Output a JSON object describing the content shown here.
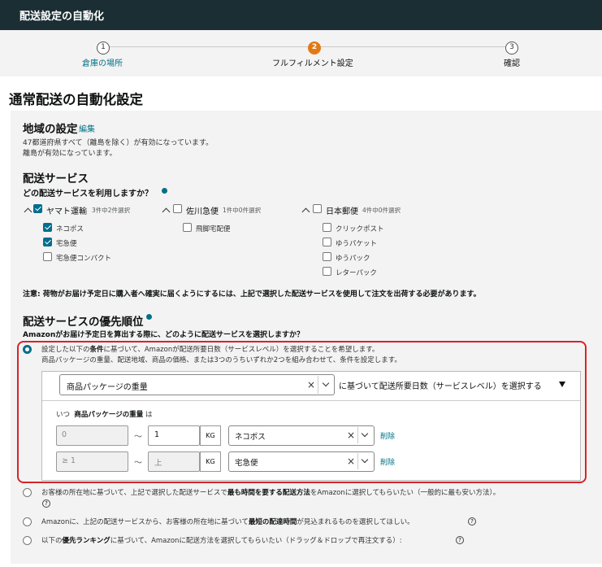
{
  "header": {
    "title": "配送設定の自動化"
  },
  "steps": [
    {
      "num": "1",
      "label": "倉庫の場所",
      "state": "done"
    },
    {
      "num": "2",
      "label": "フルフィルメント設定",
      "state": "active"
    },
    {
      "num": "3",
      "label": "確認",
      "state": "pending"
    }
  ],
  "page_title": "通常配送の自動化設定",
  "region": {
    "title": "地域の設定",
    "edit": "編集",
    "line1": "47都道府県すべて（離島を除く）が有効になっています。",
    "line2": "離島が有効になっています。"
  },
  "services": {
    "title": "配送サービス",
    "question": "どの配送サービスを利用しますか？",
    "carriers": [
      {
        "name": "ヤマト運輸",
        "count": "3件中2件選択",
        "checked": true,
        "items": [
          {
            "label": "ネコポス",
            "checked": true
          },
          {
            "label": "宅急便",
            "checked": true
          },
          {
            "label": "宅急便コンパクト",
            "checked": false
          }
        ]
      },
      {
        "name": "佐川急便",
        "count": "1件中0件選択",
        "checked": false,
        "items": [
          {
            "label": "飛脚宅配便",
            "checked": false
          }
        ]
      },
      {
        "name": "日本郵便",
        "count": "4件中0件選択",
        "checked": false,
        "items": [
          {
            "label": "クリックポスト",
            "checked": false
          },
          {
            "label": "ゆうパケット",
            "checked": false
          },
          {
            "label": "ゆうパック",
            "checked": false
          },
          {
            "label": "レターパック",
            "checked": false
          }
        ]
      }
    ],
    "note": "注意: 荷物がお届け予定日に購入者へ確実に届くようにするには、上記で選択した配送サービスを使用して注文を出荷する必要があります。"
  },
  "priority": {
    "title": "配送サービスの優先順位",
    "question": "Amazonがお届け予定日を算出する際に、どのように配送サービスを選択しますか？",
    "opt1": {
      "a": "設定した以下の",
      "b": "条件",
      "c": "に基づいて、Amazonが配送所要日数（サービスレベル）を選択することを希望します。",
      "sub": "商品パッケージの重量、配送地域、商品の価格、または3つのうちいずれか2つを組み合わせて、条件を設定します。"
    },
    "condition": {
      "select": "商品パッケージの重量",
      "suffix": "に基づいて配送所要日数（サービスレベル）を選択する",
      "when_a": "いつ",
      "when_b": "商品パッケージの重量",
      "when_c": "は",
      "rows": [
        {
          "from": "0",
          "from_ph": "",
          "to": "1",
          "to_ph": "",
          "unit": "KG",
          "service": "ネコポス",
          "delete": "削除"
        },
        {
          "from": "",
          "from_ph": "≥ 1",
          "to": "",
          "to_ph": "上",
          "unit": "KG",
          "service": "宅急便",
          "delete": "削除"
        }
      ],
      "tilde": "～"
    },
    "opt2": {
      "a": "お客様の所在地に基づいて、上記で選択した配送サービスで",
      "b": "最も時間を要する配送方法",
      "c": "をAmazonに選択してもらいたい（一般的に最も安い方法）。"
    },
    "opt3": {
      "a": "Amazonに、上記の配送サービスから、お客様の所在地に基づいて",
      "b": "最短の配達時間",
      "c": "が見込まれるものを選択してほしい。"
    },
    "opt4": {
      "a": "以下の",
      "b": "優先ランキング",
      "c": "に基づいて、Amazonに配送方法を選択してもらいたい（ドラッグ＆ドロップで再注文する）:"
    }
  },
  "colors": {
    "header_bg": "#1a2e33",
    "accent": "#e47911",
    "link": "#007185",
    "checkbox": "#006e8c",
    "highlight": "#d8232a"
  }
}
